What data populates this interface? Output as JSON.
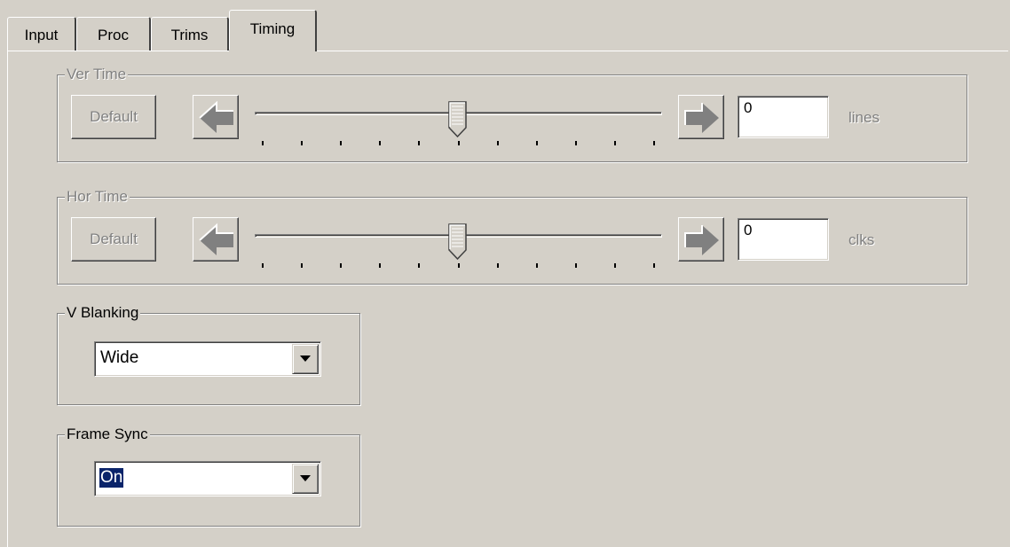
{
  "tabs": [
    {
      "label": "Input",
      "active": false
    },
    {
      "label": "Proc",
      "active": false
    },
    {
      "label": "Trims",
      "active": false
    },
    {
      "label": "Timing",
      "active": true
    }
  ],
  "ver_time": {
    "title": "Ver Time",
    "default_label": "Default",
    "value": "0",
    "unit": "lines",
    "left_icon": "arrow-left-icon",
    "right_icon": "arrow-right-icon",
    "slider_position": 0.5,
    "enabled": false
  },
  "hor_time": {
    "title": "Hor Time",
    "default_label": "Default",
    "value": "0",
    "unit": "clks",
    "left_icon": "arrow-left-icon",
    "right_icon": "arrow-right-icon",
    "slider_position": 0.5,
    "enabled": false
  },
  "v_blanking": {
    "title": "V Blanking",
    "value": "Wide",
    "dropdown_icon": "chevron-down-icon"
  },
  "frame_sync": {
    "title": "Frame Sync",
    "value": "On",
    "selected": true,
    "dropdown_icon": "chevron-down-icon"
  },
  "colors": {
    "face": "#d4d0c8",
    "shadow": "#808080",
    "dark_shadow": "#404040",
    "highlight": "#ffffff",
    "disabled_text": "#808080",
    "selection": "#0a246a"
  }
}
